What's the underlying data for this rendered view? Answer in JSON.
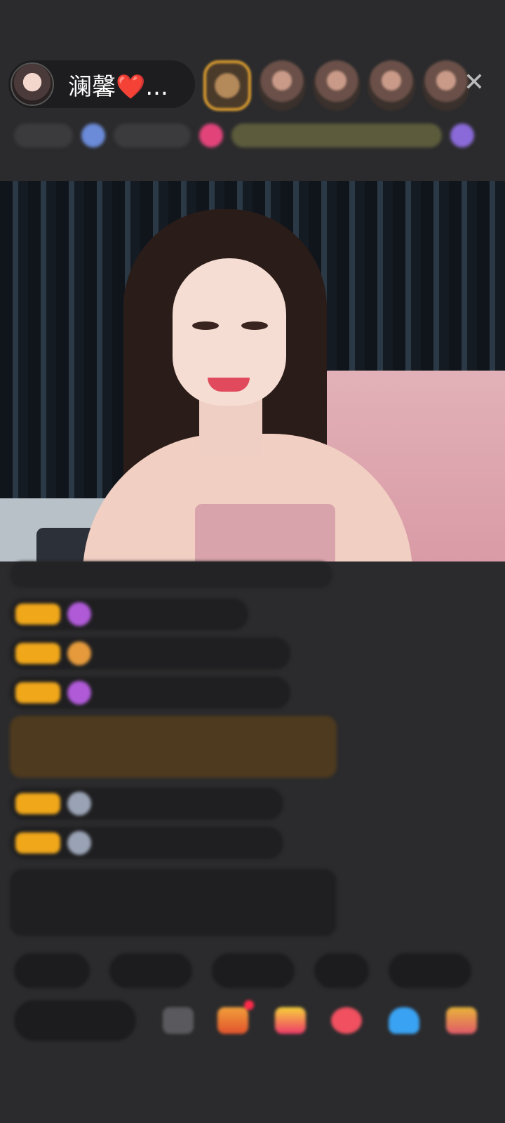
{
  "header": {
    "host_name": "澜馨❤️...",
    "close_glyph": "✕",
    "viewer_avatars": [
      "avatar",
      "avatar",
      "avatar",
      "avatar",
      "avatar"
    ]
  },
  "icons": {
    "close": "close-icon",
    "host_avatar": "host-avatar"
  },
  "colors": {
    "badge": "#f0a71a",
    "highlight_message_bg": "#4e3a1e",
    "notice_text": "#8fe08a",
    "notification_dot": "#ff2a4a"
  }
}
